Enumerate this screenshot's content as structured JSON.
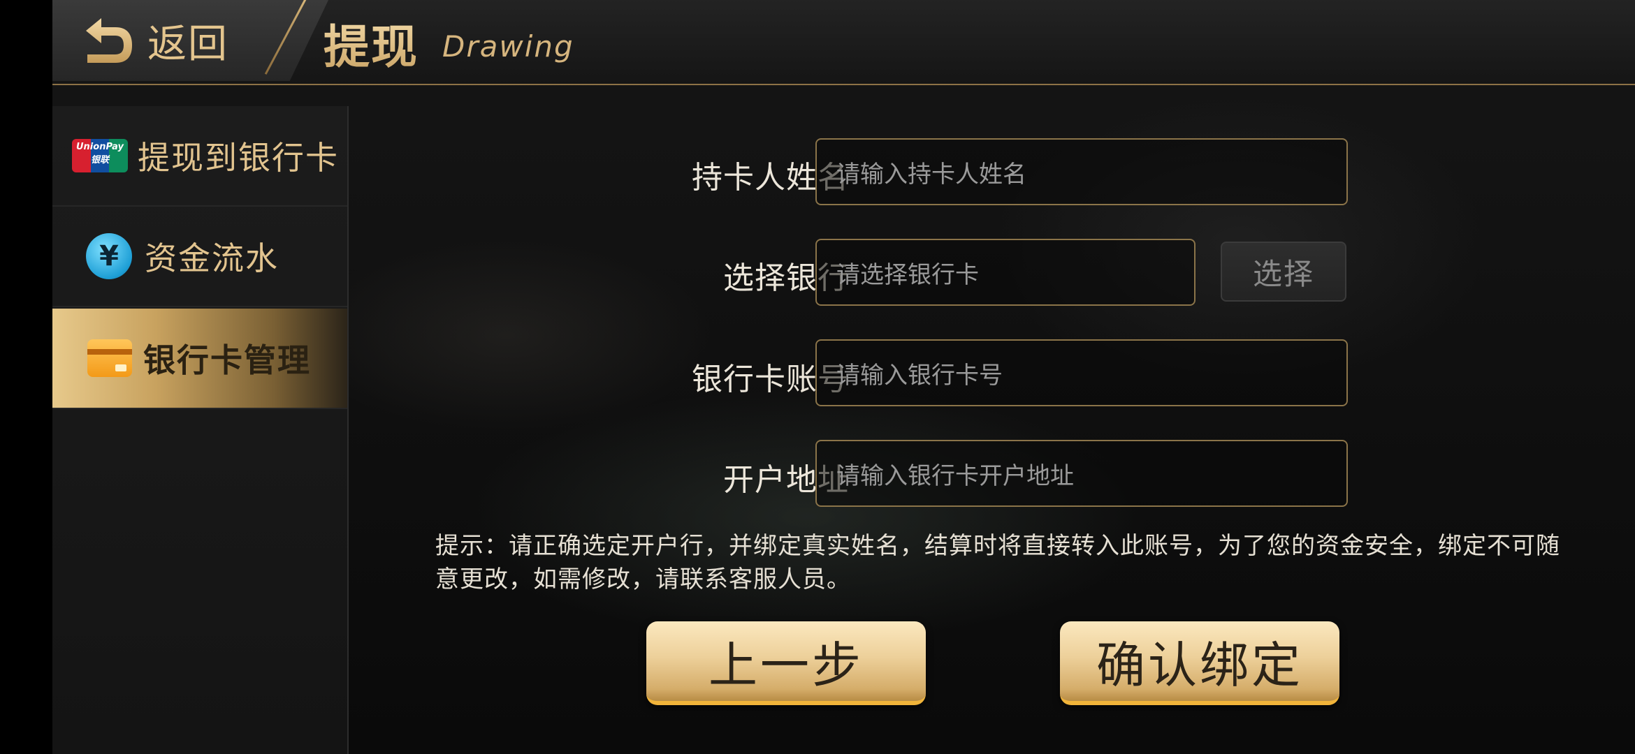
{
  "header": {
    "back_label": "返回",
    "title": "提现",
    "subtitle": "Drawing"
  },
  "sidebar": {
    "items": [
      {
        "label": "提现到银行卡",
        "icon": "unionpay-icon",
        "icon_text": "UnionPay 银联",
        "active": false
      },
      {
        "label": "资金流水",
        "icon": "yuan-icon",
        "icon_text": "¥",
        "active": false
      },
      {
        "label": "银行卡管理",
        "icon": "bank-card-icon",
        "active": true
      }
    ]
  },
  "form": {
    "cardholder": {
      "label": "持卡人姓名",
      "placeholder": "请输入持卡人姓名"
    },
    "bank": {
      "label": "选择银行",
      "placeholder": "请选择银行卡",
      "button_label": "选择"
    },
    "card_number": {
      "label": "银行卡账号",
      "placeholder": "请输入银行卡号"
    },
    "address": {
      "label": "开户地址",
      "placeholder": "请输入银行卡开户地址"
    }
  },
  "tip": "提示：请正确选定开户行，并绑定真实姓名，结算时将直接转入此账号，为了您的资金安全，绑定不可随意更改，如需修改，请联系客服人员。",
  "buttons": {
    "prev_label": "上一步",
    "confirm_label": "确认绑定"
  },
  "colors": {
    "accent_gold": "#e4c58e",
    "active_tab_gold": "#d9b673",
    "input_border": "#8b7449",
    "background": "#121212"
  }
}
